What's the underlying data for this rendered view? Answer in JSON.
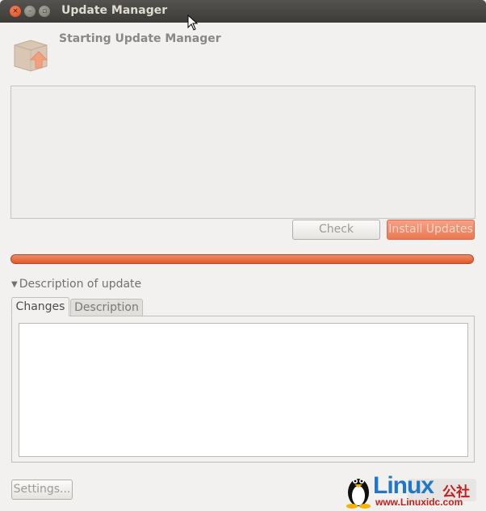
{
  "window": {
    "title": "Update Manager",
    "close_glyph": "×",
    "min_glyph": "–",
    "max_glyph": "▫"
  },
  "header": {
    "text": "Starting Update Manager",
    "icon": "package-upgrade-icon"
  },
  "buttons": {
    "check": "Check",
    "install": "Install Updates",
    "settings": "Settings..."
  },
  "progress": {
    "fraction": 1.0,
    "color": "#e96b3c"
  },
  "description": {
    "expander_label": "Description of update",
    "tabs": [
      {
        "label": "Changes",
        "selected": true
      },
      {
        "label": "Description",
        "selected": false
      }
    ]
  },
  "watermark": {
    "brand": "Linux",
    "brand_cn": "公社",
    "url": "www.Linuxidc.com"
  },
  "colors": {
    "accent": "#e96b3c",
    "titlebar": "#3c3b37"
  }
}
